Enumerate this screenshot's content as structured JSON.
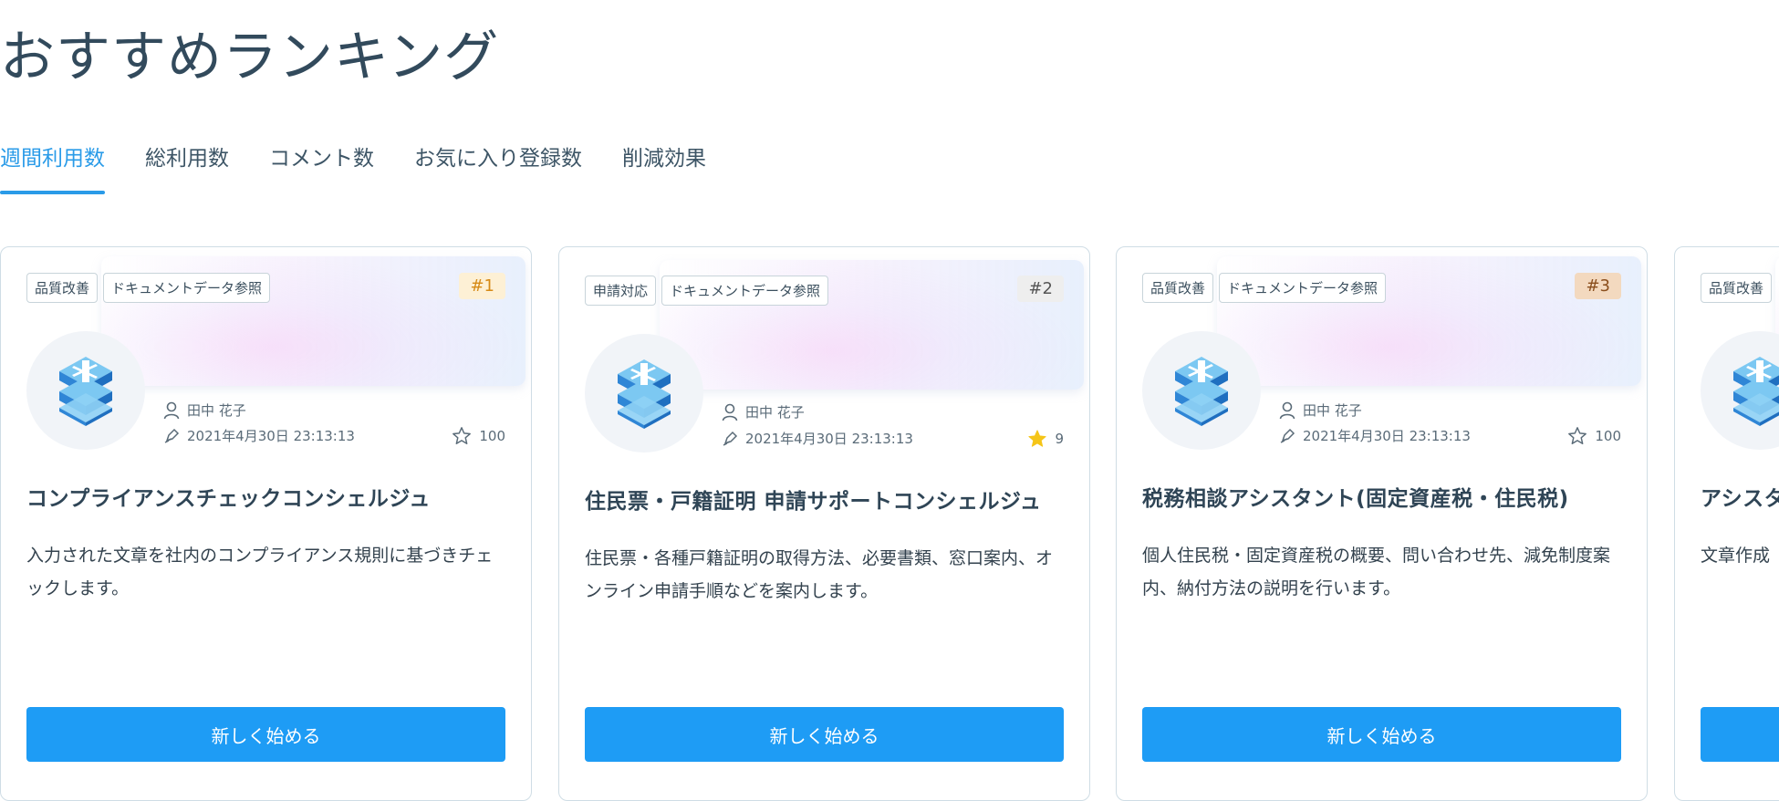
{
  "page": {
    "title": "おすすめランキング"
  },
  "tabs": [
    {
      "label": "週間利用数",
      "active": true
    },
    {
      "label": "総利用数",
      "active": false
    },
    {
      "label": "コメント数",
      "active": false
    },
    {
      "label": "お気に入り登録数",
      "active": false
    },
    {
      "label": "削減効果",
      "active": false
    }
  ],
  "colors": {
    "accent": "#2a9be8",
    "button": "#1e9cf5",
    "rank1": "#d68a16",
    "rank3": "#8a4e1d",
    "star_filled": "#f5c518"
  },
  "cards": [
    {
      "tags": [
        "品質改善",
        "ドキュメントデータ参照"
      ],
      "rank": "#1",
      "author": "田中 花子",
      "date": "2021年4月30日 23:13:13",
      "favorites": "100",
      "favorited": false,
      "title": "コンプライアンスチェックコンシェルジュ",
      "description": "入力された文章を社内のコンプライアンス規則に基づきチェックします。",
      "button": "新しく始める"
    },
    {
      "tags": [
        "申請対応",
        "ドキュメントデータ参照"
      ],
      "rank": "#2",
      "author": "田中 花子",
      "date": "2021年4月30日 23:13:13",
      "favorites": "9",
      "favorited": true,
      "title": "住民票・戸籍証明 申請サポートコンシェルジュ",
      "description": "住民票・各種戸籍証明の取得方法、必要書類、窓口案内、オンライン申請手順などを案内します。",
      "button": "新しく始める"
    },
    {
      "tags": [
        "品質改善",
        "ドキュメントデータ参照"
      ],
      "rank": "#3",
      "author": "田中 花子",
      "date": "2021年4月30日 23:13:13",
      "favorites": "100",
      "favorited": false,
      "title": "税務相談アシスタント(固定資産税・住民税)",
      "description": "個人住民税・固定資産税の概要、問い合わせ先、減免制度案内、納付方法の説明を行います。",
      "button": "新しく始める"
    },
    {
      "tags": [
        "品質改善"
      ],
      "rank": "",
      "author": "",
      "date": "",
      "favorites": "",
      "favorited": false,
      "title": "アシスタ",
      "description": "文章作成",
      "button": ""
    }
  ]
}
